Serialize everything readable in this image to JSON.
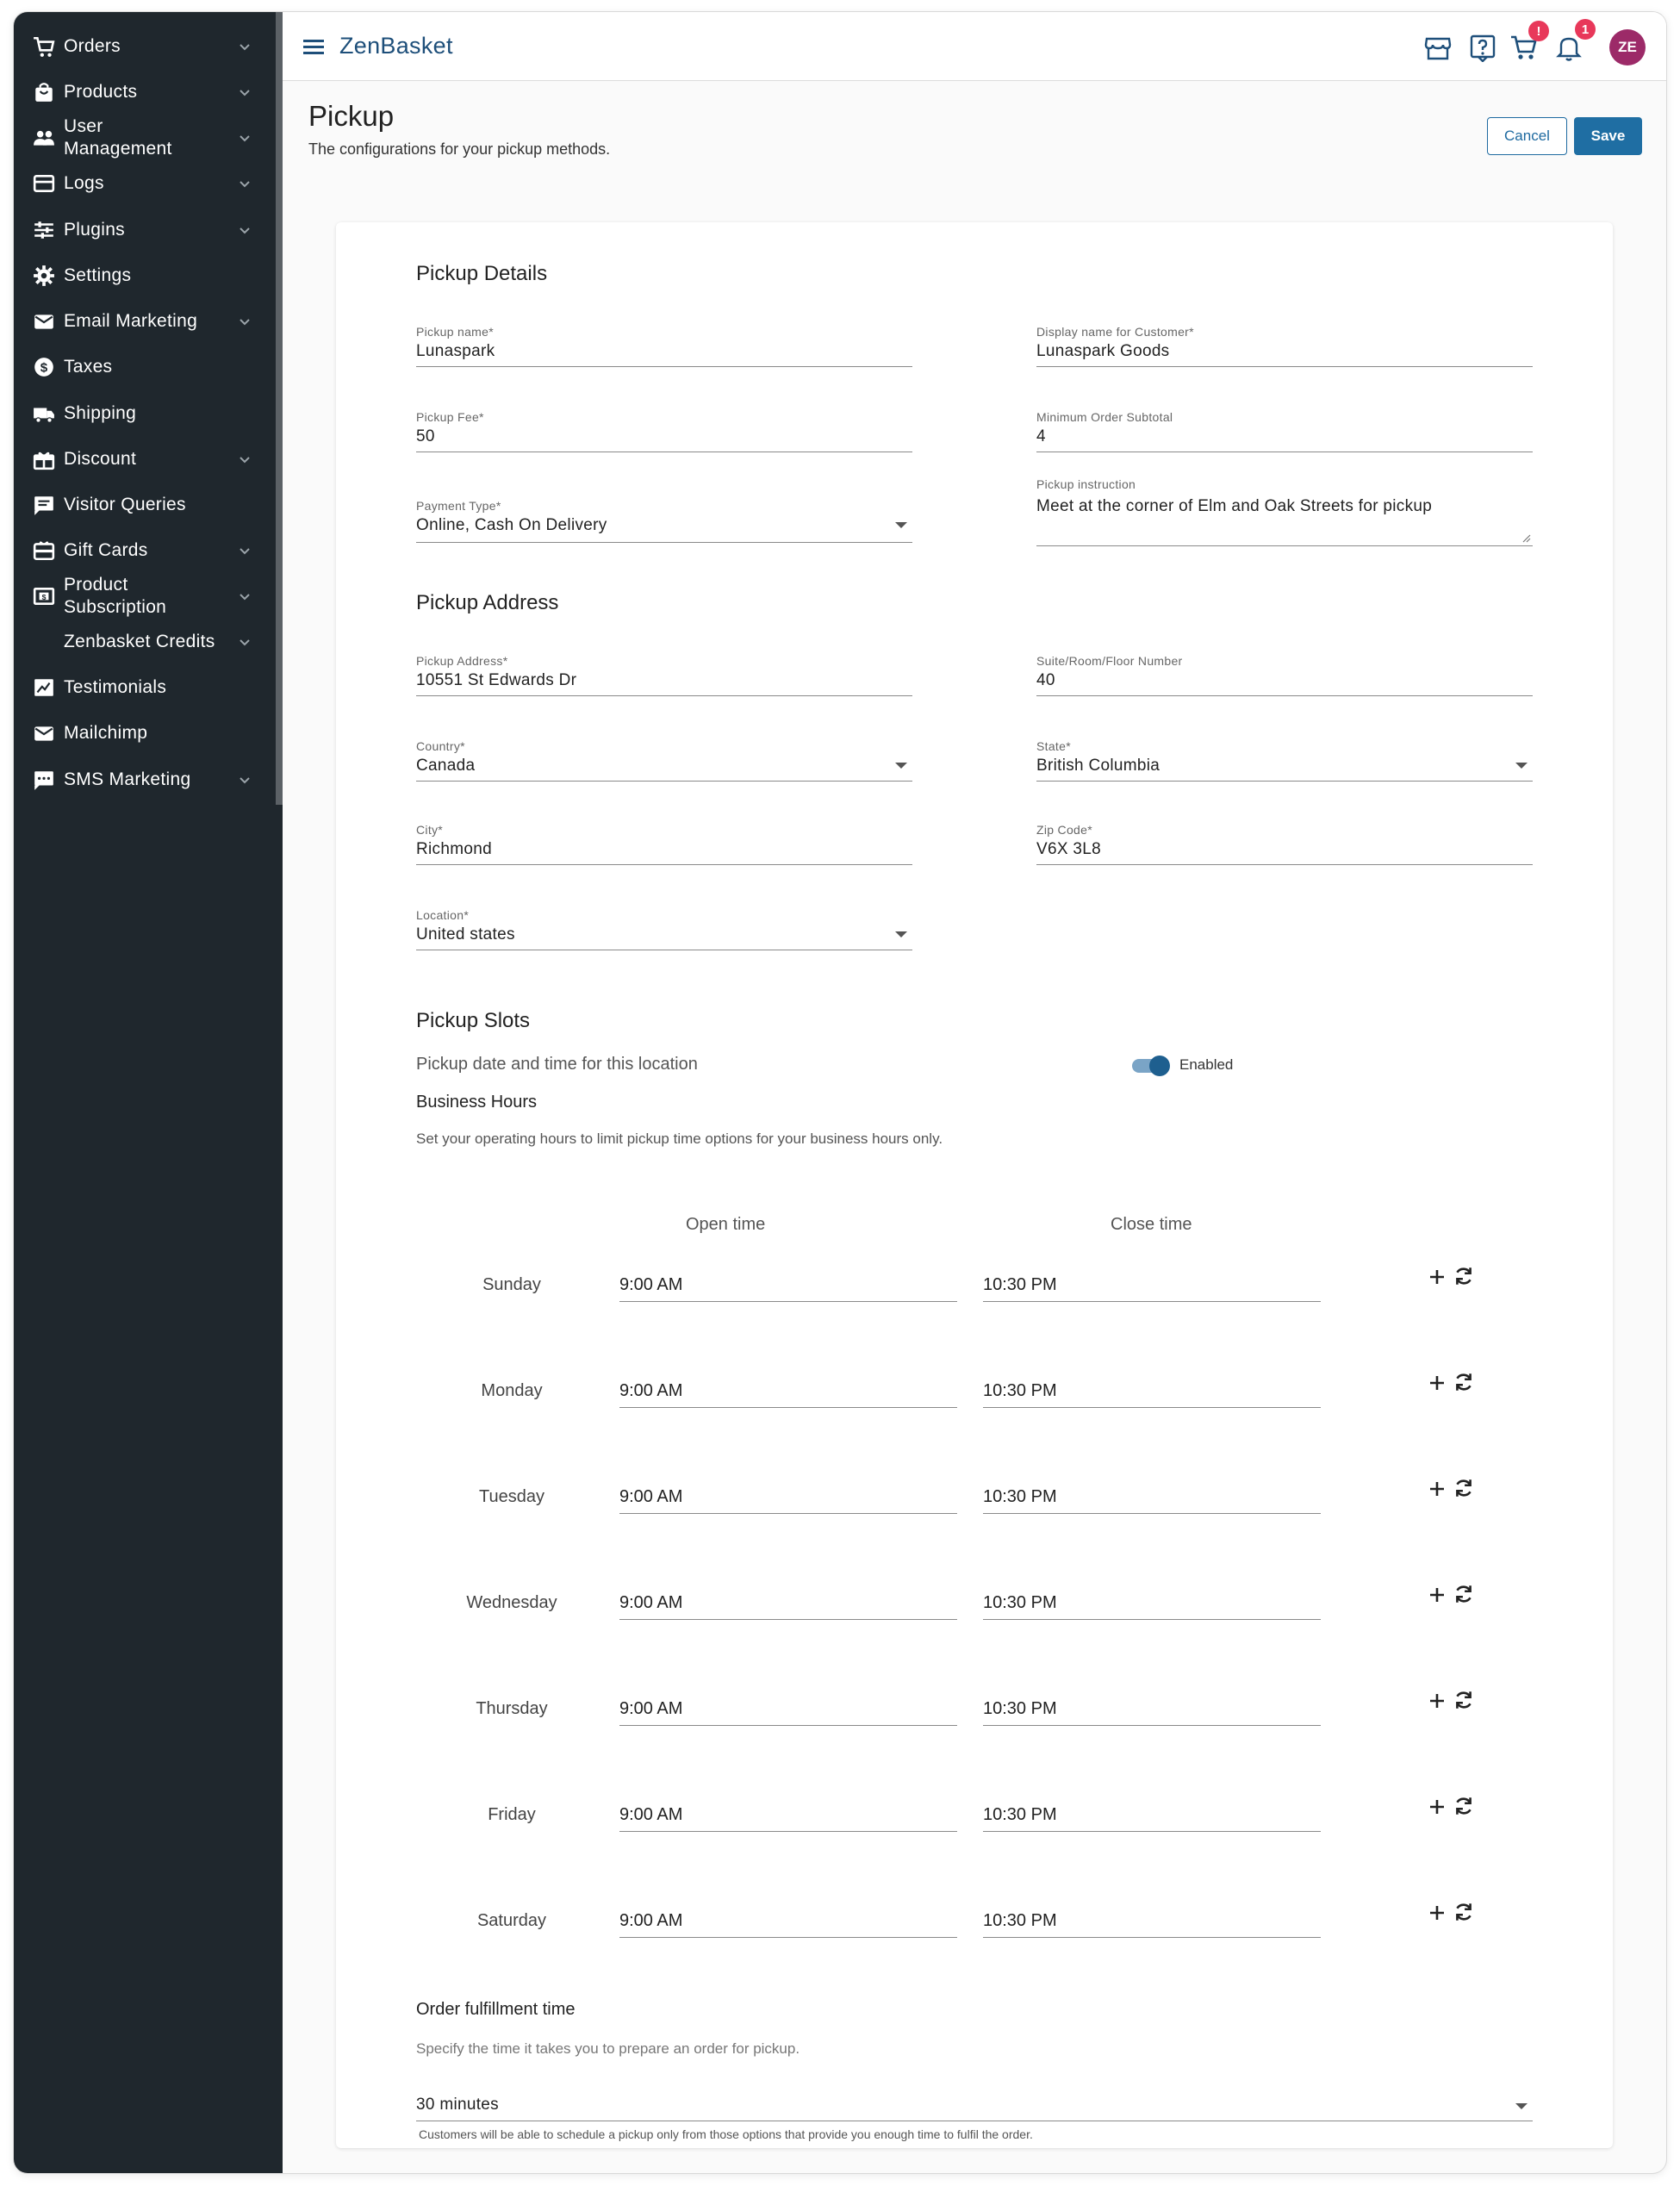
{
  "sidebar": {
    "items": [
      {
        "label": "Orders",
        "icon": "cart-icon",
        "chevron": true
      },
      {
        "label": "Products",
        "icon": "shopping-bag-icon",
        "chevron": true
      },
      {
        "label": "User\nManagement",
        "icon": "users-icon",
        "chevron": true
      },
      {
        "label": "Logs",
        "icon": "logs-icon",
        "chevron": true
      },
      {
        "label": "Plugins",
        "icon": "sliders-icon",
        "chevron": true
      },
      {
        "label": "Settings",
        "icon": "gear-icon",
        "chevron": false
      },
      {
        "label": "Email Marketing",
        "icon": "mail-icon",
        "chevron": true
      },
      {
        "label": "Taxes",
        "icon": "dollar-circle-icon",
        "chevron": false
      },
      {
        "label": "Shipping",
        "icon": "truck-icon",
        "chevron": false
      },
      {
        "label": "Discount",
        "icon": "gift-box-icon",
        "chevron": true
      },
      {
        "label": "Visitor Queries",
        "icon": "chat-icon",
        "chevron": false
      },
      {
        "label": "Gift Cards",
        "icon": "gift-card-icon",
        "chevron": true
      },
      {
        "label": "Product\nSubscription",
        "icon": "subscription-icon",
        "chevron": true
      },
      {
        "label": "Zenbasket Credits",
        "icon": "",
        "chevron": true
      },
      {
        "label": "Testimonials",
        "icon": "testimonial-icon",
        "chevron": false
      },
      {
        "label": "Mailchimp",
        "icon": "mail-icon",
        "chevron": false
      },
      {
        "label": "SMS Marketing",
        "icon": "sms-icon",
        "chevron": true
      }
    ]
  },
  "topbar": {
    "brand": "ZenBasket",
    "cart_badge": "!",
    "notification_badge": "1",
    "avatar_initials": "ZE"
  },
  "header": {
    "title": "Pickup",
    "subtitle": "The configurations for your pickup methods.",
    "cancel_label": "Cancel",
    "save_label": "Save"
  },
  "pickup_details": {
    "title": "Pickup Details",
    "pickup_name": {
      "label": "Pickup name*",
      "value": "Lunaspark"
    },
    "display_name": {
      "label": "Display name for Customer*",
      "value": "Lunaspark Goods"
    },
    "pickup_fee": {
      "label": "Pickup Fee*",
      "value": "50"
    },
    "min_subtotal": {
      "label": "Minimum Order Subtotal",
      "value": "4"
    },
    "payment_type": {
      "label": "Payment Type*",
      "value": "Online, Cash On Delivery"
    },
    "instruction": {
      "label": "Pickup instruction",
      "value": "Meet at the corner of Elm and Oak Streets for pickup"
    }
  },
  "pickup_address": {
    "title": "Pickup Address",
    "address": {
      "label": "Pickup Address*",
      "value": "10551 St Edwards Dr"
    },
    "suite": {
      "label": "Suite/Room/Floor Number",
      "value": "40"
    },
    "country": {
      "label": "Country*",
      "value": "Canada"
    },
    "state": {
      "label": "State*",
      "value": "British Columbia"
    },
    "city": {
      "label": "City*",
      "value": "Richmond"
    },
    "zip": {
      "label": "Zip Code*",
      "value": "V6X 3L8"
    },
    "location": {
      "label": "Location*",
      "value": "United states"
    }
  },
  "pickup_slots": {
    "title": "Pickup Slots",
    "toggle_text": "Pickup date and time for this location",
    "toggle_state": "Enabled",
    "business_hours_title": "Business Hours",
    "business_hours_desc": "Set your operating hours to limit pickup time options for your business hours only.",
    "open_header": "Open time",
    "close_header": "Close time",
    "days": [
      {
        "day": "Sunday",
        "open": "9:00 AM",
        "close": "10:30 PM"
      },
      {
        "day": "Monday",
        "open": "9:00 AM",
        "close": "10:30 PM"
      },
      {
        "day": "Tuesday",
        "open": "9:00 AM",
        "close": "10:30 PM"
      },
      {
        "day": "Wednesday",
        "open": "9:00 AM",
        "close": "10:30 PM"
      },
      {
        "day": "Thursday",
        "open": "9:00 AM",
        "close": "10:30 PM"
      },
      {
        "day": "Friday",
        "open": "9:00 AM",
        "close": "10:30 PM"
      },
      {
        "day": "Saturday",
        "open": "9:00 AM",
        "close": "10:30 PM"
      }
    ]
  },
  "fulfillment": {
    "title": "Order fulfillment time",
    "desc": "Specify the time it takes you to prepare an order for pickup.",
    "value": "30 minutes",
    "hint": "Customers will be able to schedule a pickup only from those options that provide you enough time to fulfil the order."
  },
  "colors": {
    "sidebar_bg": "#1f272d",
    "brand": "#1e4f7a",
    "primary": "#1f6ea3",
    "badge": "#e8385a",
    "avatar": "#9c2a68"
  }
}
